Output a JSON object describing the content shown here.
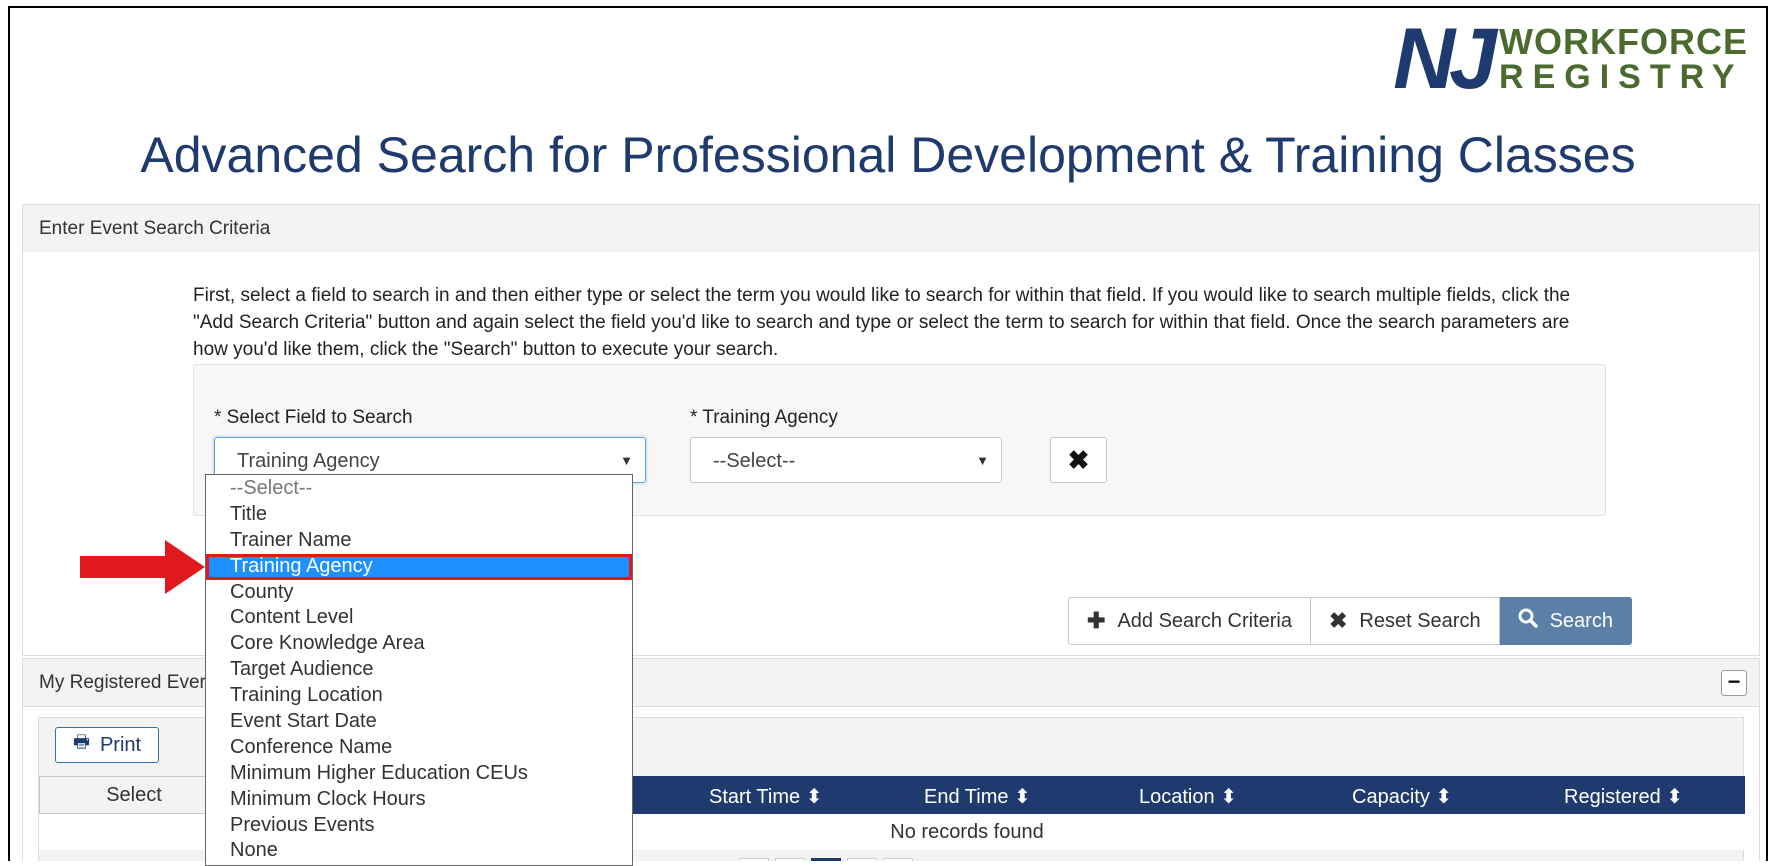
{
  "logo": {
    "mark": "NJ",
    "line1": "WORKFORCE",
    "line2": "REGISTRY"
  },
  "page_title": "Advanced Search for Professional Development & Training Classes",
  "search_panel": {
    "header": "Enter Event Search Criteria",
    "instructions": "First, select a field to search in and then either type or select the term you would like to search for within that field. If you would like to search multiple fields, click the \"Add Search Criteria\" button and again select the field you'd like to search and type or select the term to search for within that field. Once the search parameters are how you'd like them, click the \"Search\" button to execute your search.",
    "field_label": "* Select Field to Search",
    "field_value": "Training Agency",
    "term_label": "* Training Agency",
    "term_value": "--Select--",
    "remove_icon": "times-icon",
    "buttons": {
      "add": "Add Search Criteria",
      "reset": "Reset Search",
      "search": "Search"
    }
  },
  "dropdown": {
    "options": [
      "--Select--",
      "Title",
      "Trainer Name",
      "Training Agency",
      "County",
      "Content Level",
      "Core Knowledge Area",
      "Target Audience",
      "Training Location",
      "Event Start Date",
      "Conference Name",
      "Minimum Higher Education CEUs",
      "Minimum Clock Hours",
      "Previous Events",
      "None"
    ],
    "selected": "Training Agency"
  },
  "registered_panel": {
    "header": "My Registered Ever",
    "print_label": "Print",
    "columns": {
      "select": "Select",
      "start_time": "Start Time",
      "end_time": "End Time",
      "location": "Location",
      "capacity": "Capacity",
      "registered": "Registered"
    },
    "empty_message": "No records found"
  },
  "colors": {
    "brand_navy": "#1f3a6e",
    "brand_green": "#4a6a2e",
    "search_button": "#5b7fa6",
    "highlight": "#1e90ff",
    "annotation_red": "#e0191f"
  }
}
